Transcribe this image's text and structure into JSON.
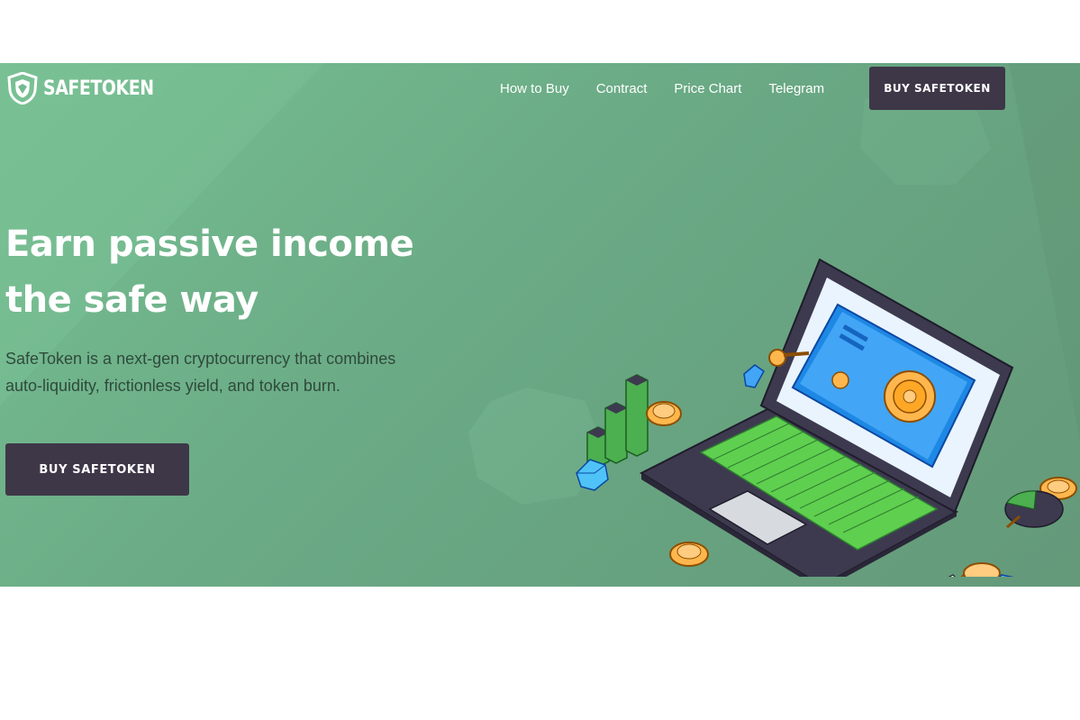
{
  "brand": {
    "name": "SAFETOKEN",
    "logo_icon": "shield-icon"
  },
  "nav": {
    "links": [
      "How to Buy",
      "Contract",
      "Price Chart",
      "Telegram"
    ],
    "cta_label": "BUY SAFETOKEN"
  },
  "hero": {
    "headline_line1": "Earn passive income",
    "headline_line2": "the safe way",
    "subtext_line1": "SafeToken is a next-gen cryptocurrency that combines",
    "subtext_line2": "auto-liquidity, frictionless yield, and token burn.",
    "cta_label": "BUY SAFETOKEN",
    "illustration": "laptop-vault-illustration"
  },
  "colors": {
    "hero_bg": "#6daf89",
    "button_bg": "#3e3748",
    "text_white": "#ffffff",
    "subtext": "#2f4a3c"
  }
}
